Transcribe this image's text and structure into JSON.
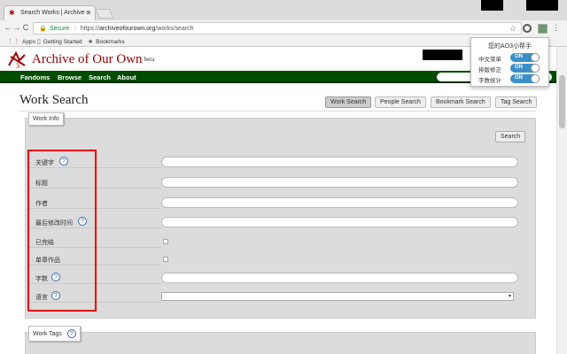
{
  "browser": {
    "tab_title": "Search Works | Archive o",
    "tab_close": "×",
    "url_secure": "Secure",
    "url_scheme": "https://",
    "url_host": "archiveofourown.org",
    "url_path": "/works/search",
    "bookmarks": [
      {
        "label": "Apps",
        "icon": "apps-grid-icon"
      },
      {
        "label": "Getting Started",
        "icon": "page-icon"
      },
      {
        "label": "Bookmarks",
        "icon": "star-icon"
      }
    ]
  },
  "site": {
    "logo_text": "Archive of Our Own",
    "logo_beta": "beta",
    "nav": [
      "Fandoms",
      "Browse",
      "Search",
      "About"
    ],
    "accent_color": "#004d00",
    "brand_color": "#990000"
  },
  "main": {
    "page_title": "Work Search",
    "search_tabs": [
      "Work Search",
      "People Search",
      "Bookmark Search",
      "Tag Search"
    ],
    "work_info_legend": "Work Info",
    "search_button": "Search",
    "fields": [
      {
        "label": "关键字",
        "help": true,
        "type": "text"
      },
      {
        "label": "标题",
        "help": false,
        "type": "text"
      },
      {
        "label": "作者",
        "help": false,
        "type": "text"
      },
      {
        "label": "最后修改时间",
        "help": true,
        "type": "text"
      },
      {
        "label": "已完结",
        "help": false,
        "type": "checkbox"
      },
      {
        "label": "单章作品",
        "help": false,
        "type": "checkbox"
      },
      {
        "label": "字数",
        "help": true,
        "type": "text"
      },
      {
        "label": "语言",
        "help": true,
        "type": "select"
      }
    ],
    "help_glyph": "?",
    "work_tags_legend": "Work Tags"
  },
  "extension_popup": {
    "title": "您的AO3小帮手",
    "toggles": [
      {
        "label": "中文菜单",
        "state": "ON"
      },
      {
        "label": "排版修正",
        "state": "ON"
      },
      {
        "label": "字数统计",
        "state": "ON"
      }
    ]
  }
}
